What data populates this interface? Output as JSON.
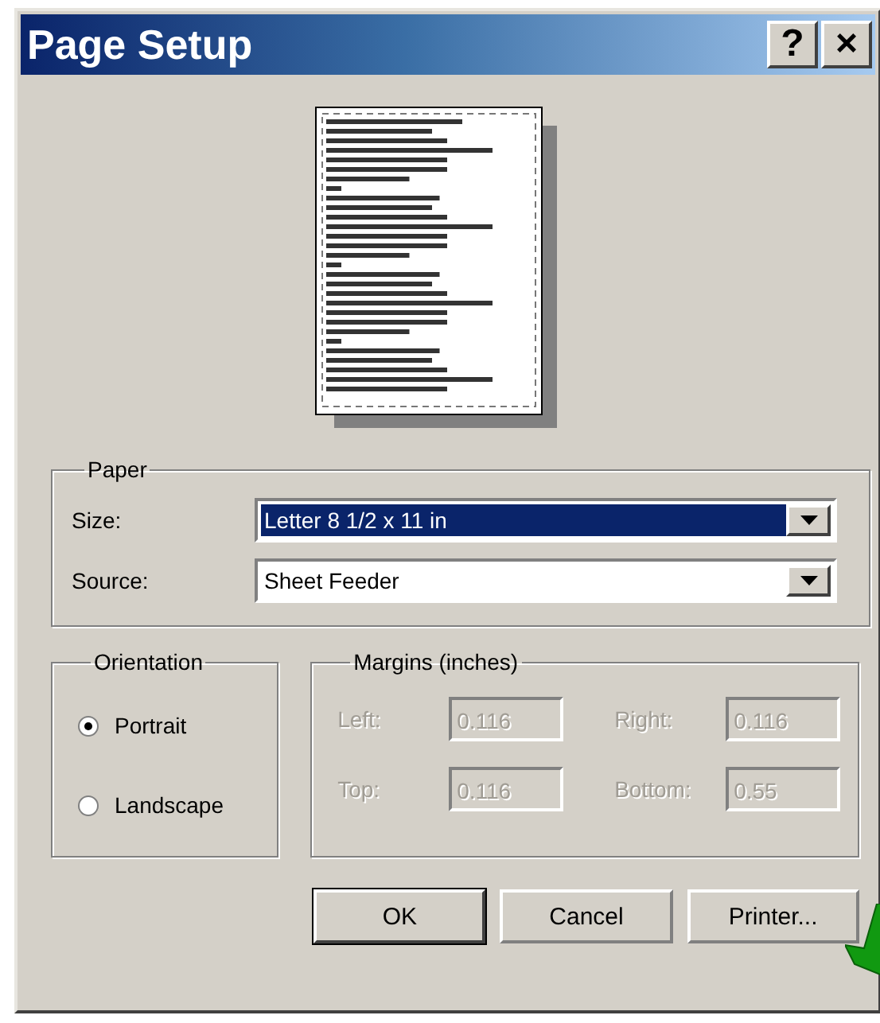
{
  "window": {
    "title": "Page Setup",
    "help_button": "?",
    "close_button": "×"
  },
  "paper": {
    "label": "Paper",
    "fields": [
      {
        "label": "Size:",
        "value": "Letter 8 1/2 x 11 in",
        "focused": true
      },
      {
        "label": "Source:",
        "value": "Sheet Feeder",
        "focused": false
      }
    ]
  },
  "orientation": {
    "label": "Orientation",
    "options": [
      {
        "label": "Portrait",
        "selected": true
      },
      {
        "label": "Landscape",
        "selected": false
      }
    ]
  },
  "margins": {
    "label": "Margins (inches)",
    "disabled": true,
    "fields": [
      {
        "label": "Left:",
        "value": "0.116"
      },
      {
        "label": "Right:",
        "value": "0.116"
      },
      {
        "label": "Top:",
        "value": "0.116"
      },
      {
        "label": "Bottom:",
        "value": "0.55"
      }
    ]
  },
  "buttons": [
    {
      "label": "OK",
      "default": true
    },
    {
      "label": "Cancel",
      "default": false
    },
    {
      "label": "Printer...",
      "default": false
    }
  ]
}
